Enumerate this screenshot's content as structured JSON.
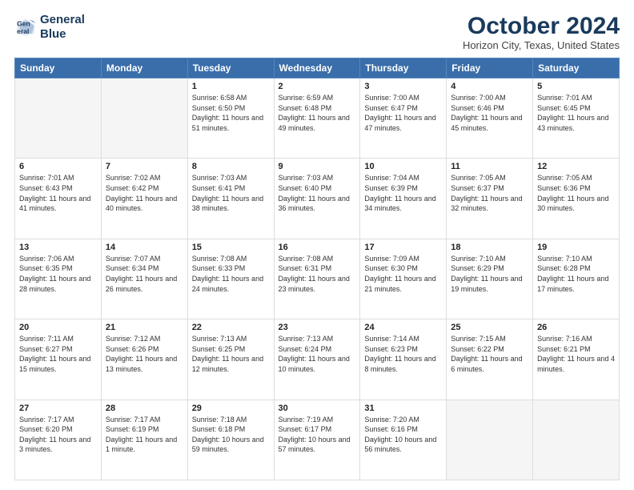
{
  "logo": {
    "line1": "General",
    "line2": "Blue"
  },
  "title": "October 2024",
  "location": "Horizon City, Texas, United States",
  "days_of_week": [
    "Sunday",
    "Monday",
    "Tuesday",
    "Wednesday",
    "Thursday",
    "Friday",
    "Saturday"
  ],
  "weeks": [
    [
      {
        "num": "",
        "sunrise": "",
        "sunset": "",
        "daylight": ""
      },
      {
        "num": "",
        "sunrise": "",
        "sunset": "",
        "daylight": ""
      },
      {
        "num": "1",
        "sunrise": "Sunrise: 6:58 AM",
        "sunset": "Sunset: 6:50 PM",
        "daylight": "Daylight: 11 hours and 51 minutes."
      },
      {
        "num": "2",
        "sunrise": "Sunrise: 6:59 AM",
        "sunset": "Sunset: 6:48 PM",
        "daylight": "Daylight: 11 hours and 49 minutes."
      },
      {
        "num": "3",
        "sunrise": "Sunrise: 7:00 AM",
        "sunset": "Sunset: 6:47 PM",
        "daylight": "Daylight: 11 hours and 47 minutes."
      },
      {
        "num": "4",
        "sunrise": "Sunrise: 7:00 AM",
        "sunset": "Sunset: 6:46 PM",
        "daylight": "Daylight: 11 hours and 45 minutes."
      },
      {
        "num": "5",
        "sunrise": "Sunrise: 7:01 AM",
        "sunset": "Sunset: 6:45 PM",
        "daylight": "Daylight: 11 hours and 43 minutes."
      }
    ],
    [
      {
        "num": "6",
        "sunrise": "Sunrise: 7:01 AM",
        "sunset": "Sunset: 6:43 PM",
        "daylight": "Daylight: 11 hours and 41 minutes."
      },
      {
        "num": "7",
        "sunrise": "Sunrise: 7:02 AM",
        "sunset": "Sunset: 6:42 PM",
        "daylight": "Daylight: 11 hours and 40 minutes."
      },
      {
        "num": "8",
        "sunrise": "Sunrise: 7:03 AM",
        "sunset": "Sunset: 6:41 PM",
        "daylight": "Daylight: 11 hours and 38 minutes."
      },
      {
        "num": "9",
        "sunrise": "Sunrise: 7:03 AM",
        "sunset": "Sunset: 6:40 PM",
        "daylight": "Daylight: 11 hours and 36 minutes."
      },
      {
        "num": "10",
        "sunrise": "Sunrise: 7:04 AM",
        "sunset": "Sunset: 6:39 PM",
        "daylight": "Daylight: 11 hours and 34 minutes."
      },
      {
        "num": "11",
        "sunrise": "Sunrise: 7:05 AM",
        "sunset": "Sunset: 6:37 PM",
        "daylight": "Daylight: 11 hours and 32 minutes."
      },
      {
        "num": "12",
        "sunrise": "Sunrise: 7:05 AM",
        "sunset": "Sunset: 6:36 PM",
        "daylight": "Daylight: 11 hours and 30 minutes."
      }
    ],
    [
      {
        "num": "13",
        "sunrise": "Sunrise: 7:06 AM",
        "sunset": "Sunset: 6:35 PM",
        "daylight": "Daylight: 11 hours and 28 minutes."
      },
      {
        "num": "14",
        "sunrise": "Sunrise: 7:07 AM",
        "sunset": "Sunset: 6:34 PM",
        "daylight": "Daylight: 11 hours and 26 minutes."
      },
      {
        "num": "15",
        "sunrise": "Sunrise: 7:08 AM",
        "sunset": "Sunset: 6:33 PM",
        "daylight": "Daylight: 11 hours and 24 minutes."
      },
      {
        "num": "16",
        "sunrise": "Sunrise: 7:08 AM",
        "sunset": "Sunset: 6:31 PM",
        "daylight": "Daylight: 11 hours and 23 minutes."
      },
      {
        "num": "17",
        "sunrise": "Sunrise: 7:09 AM",
        "sunset": "Sunset: 6:30 PM",
        "daylight": "Daylight: 11 hours and 21 minutes."
      },
      {
        "num": "18",
        "sunrise": "Sunrise: 7:10 AM",
        "sunset": "Sunset: 6:29 PM",
        "daylight": "Daylight: 11 hours and 19 minutes."
      },
      {
        "num": "19",
        "sunrise": "Sunrise: 7:10 AM",
        "sunset": "Sunset: 6:28 PM",
        "daylight": "Daylight: 11 hours and 17 minutes."
      }
    ],
    [
      {
        "num": "20",
        "sunrise": "Sunrise: 7:11 AM",
        "sunset": "Sunset: 6:27 PM",
        "daylight": "Daylight: 11 hours and 15 minutes."
      },
      {
        "num": "21",
        "sunrise": "Sunrise: 7:12 AM",
        "sunset": "Sunset: 6:26 PM",
        "daylight": "Daylight: 11 hours and 13 minutes."
      },
      {
        "num": "22",
        "sunrise": "Sunrise: 7:13 AM",
        "sunset": "Sunset: 6:25 PM",
        "daylight": "Daylight: 11 hours and 12 minutes."
      },
      {
        "num": "23",
        "sunrise": "Sunrise: 7:13 AM",
        "sunset": "Sunset: 6:24 PM",
        "daylight": "Daylight: 11 hours and 10 minutes."
      },
      {
        "num": "24",
        "sunrise": "Sunrise: 7:14 AM",
        "sunset": "Sunset: 6:23 PM",
        "daylight": "Daylight: 11 hours and 8 minutes."
      },
      {
        "num": "25",
        "sunrise": "Sunrise: 7:15 AM",
        "sunset": "Sunset: 6:22 PM",
        "daylight": "Daylight: 11 hours and 6 minutes."
      },
      {
        "num": "26",
        "sunrise": "Sunrise: 7:16 AM",
        "sunset": "Sunset: 6:21 PM",
        "daylight": "Daylight: 11 hours and 4 minutes."
      }
    ],
    [
      {
        "num": "27",
        "sunrise": "Sunrise: 7:17 AM",
        "sunset": "Sunset: 6:20 PM",
        "daylight": "Daylight: 11 hours and 3 minutes."
      },
      {
        "num": "28",
        "sunrise": "Sunrise: 7:17 AM",
        "sunset": "Sunset: 6:19 PM",
        "daylight": "Daylight: 11 hours and 1 minute."
      },
      {
        "num": "29",
        "sunrise": "Sunrise: 7:18 AM",
        "sunset": "Sunset: 6:18 PM",
        "daylight": "Daylight: 10 hours and 59 minutes."
      },
      {
        "num": "30",
        "sunrise": "Sunrise: 7:19 AM",
        "sunset": "Sunset: 6:17 PM",
        "daylight": "Daylight: 10 hours and 57 minutes."
      },
      {
        "num": "31",
        "sunrise": "Sunrise: 7:20 AM",
        "sunset": "Sunset: 6:16 PM",
        "daylight": "Daylight: 10 hours and 56 minutes."
      },
      {
        "num": "",
        "sunrise": "",
        "sunset": "",
        "daylight": ""
      },
      {
        "num": "",
        "sunrise": "",
        "sunset": "",
        "daylight": ""
      }
    ]
  ]
}
